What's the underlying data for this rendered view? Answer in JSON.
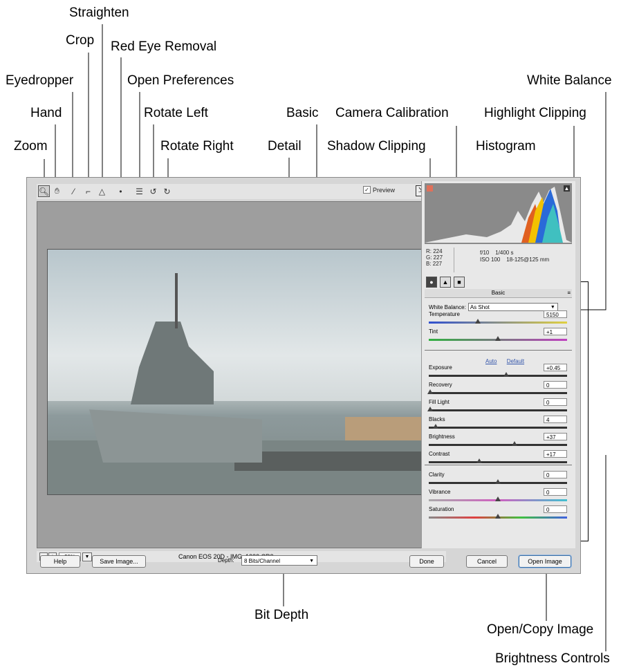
{
  "callouts": {
    "straighten": "Straighten",
    "crop": "Crop",
    "red_eye": "Red Eye Removal",
    "eyedropper": "Eyedropper",
    "open_prefs": "Open Preferences",
    "white_balance": "White Balance",
    "hand": "Hand",
    "rotate_left": "Rotate Left",
    "basic": "Basic",
    "camera_calibration": "Camera Calibration",
    "highlight_clipping": "Highlight Clipping",
    "zoom": "Zoom",
    "rotate_right": "Rotate Right",
    "detail": "Detail",
    "shadow_clipping": "Shadow Clipping",
    "histogram": "Histogram",
    "bit_depth": "Bit Depth",
    "open_copy_image": "Open/Copy Image",
    "brightness_controls": "Brightness Controls"
  },
  "toolbar": {
    "preview_label": "Preview",
    "preview_checked": true,
    "icons": [
      "zoom-icon",
      "hand-icon",
      "eyedropper-icon",
      "crop-icon",
      "straighten-icon",
      "red-eye-icon",
      "preferences-icon",
      "rotate-left-icon",
      "rotate-right-icon"
    ]
  },
  "info": {
    "r": "R:  224",
    "g": "G:  227",
    "b": "B:  227",
    "aperture": "f/10",
    "shutter": "1/400 s",
    "iso": "ISO 100",
    "lens": "18-125@125 mm"
  },
  "panel": {
    "section_title": "Basic",
    "white_balance_label": "White Balance:",
    "white_balance_value": "As Shot",
    "auto_label": "Auto",
    "default_label": "Default",
    "sliders": [
      {
        "label": "Temperature",
        "value": "5150",
        "pos": 0.35
      },
      {
        "label": "Tint",
        "value": "+1",
        "pos": 0.5
      },
      {
        "label": "Exposure",
        "value": "+0.45",
        "pos": 0.56
      },
      {
        "label": "Recovery",
        "value": "0",
        "pos": 0.0
      },
      {
        "label": "Fill Light",
        "value": "0",
        "pos": 0.0
      },
      {
        "label": "Blacks",
        "value": "4",
        "pos": 0.04
      },
      {
        "label": "Brightness",
        "value": "+37",
        "pos": 0.62
      },
      {
        "label": "Contrast",
        "value": "+17",
        "pos": 0.36
      },
      {
        "label": "Clarity",
        "value": "0",
        "pos": 0.5
      },
      {
        "label": "Vibrance",
        "value": "0",
        "pos": 0.5
      },
      {
        "label": "Saturation",
        "value": "0",
        "pos": 0.5
      }
    ]
  },
  "status": {
    "zoom_value": "20%",
    "file_info": "Canon EOS 20D  -  IMG_1222.CR2"
  },
  "buttons": {
    "help": "Help",
    "save_image": "Save Image...",
    "depth_label": "Depth:",
    "depth_value": "8 Bits/Channel",
    "done": "Done",
    "cancel": "Cancel",
    "open_image": "Open Image"
  },
  "colors": {
    "dialog_bg": "#d6d6d6",
    "shadow_clip": "#e0705a"
  }
}
